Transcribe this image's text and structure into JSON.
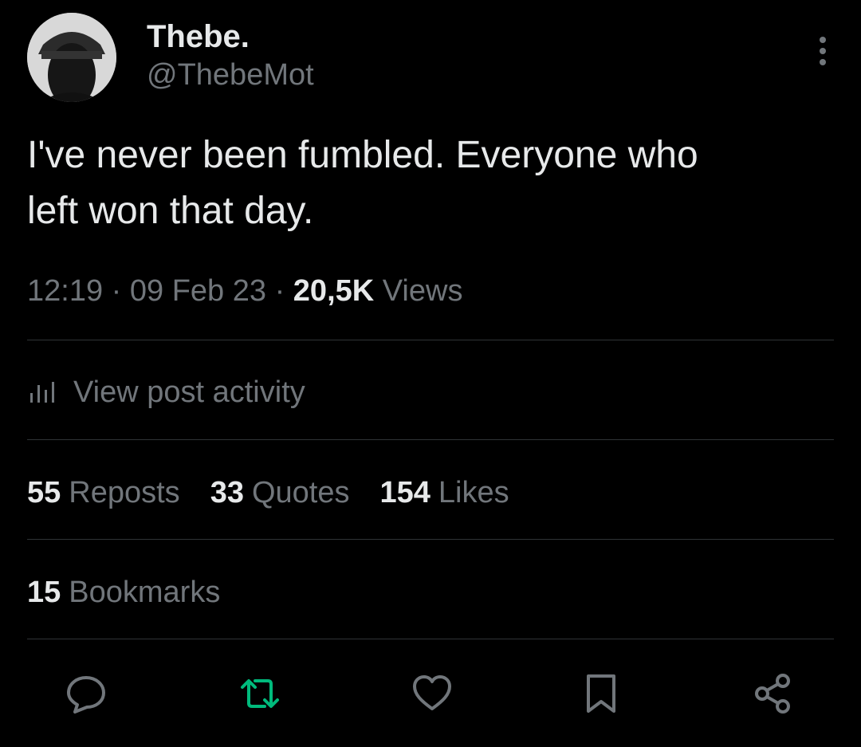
{
  "author": {
    "display_name": "Thebe.",
    "handle": "@ThebeMot"
  },
  "tweet": {
    "text": "I've never been fumbled. Everyone who\nleft won that day."
  },
  "meta": {
    "time": "12:19",
    "separator": "·",
    "date": "09 Feb 23",
    "views_count": "20,5K",
    "views_label": "Views"
  },
  "activity": {
    "label": "View post activity"
  },
  "stats": {
    "reposts_count": "55",
    "reposts_label": "Reposts",
    "quotes_count": "33",
    "quotes_label": "Quotes",
    "likes_count": "154",
    "likes_label": "Likes",
    "bookmarks_count": "15",
    "bookmarks_label": "Bookmarks"
  },
  "actions": [
    {
      "icon": "reply-icon"
    },
    {
      "icon": "repost-icon"
    },
    {
      "icon": "like-icon"
    },
    {
      "icon": "bookmark-icon"
    },
    {
      "icon": "share-icon"
    }
  ],
  "colors": {
    "background": "#000000",
    "primary_text": "#e7e9ea",
    "secondary_text": "#71767b",
    "divider": "#2f3336",
    "repost_accent": "#00ba7c"
  }
}
